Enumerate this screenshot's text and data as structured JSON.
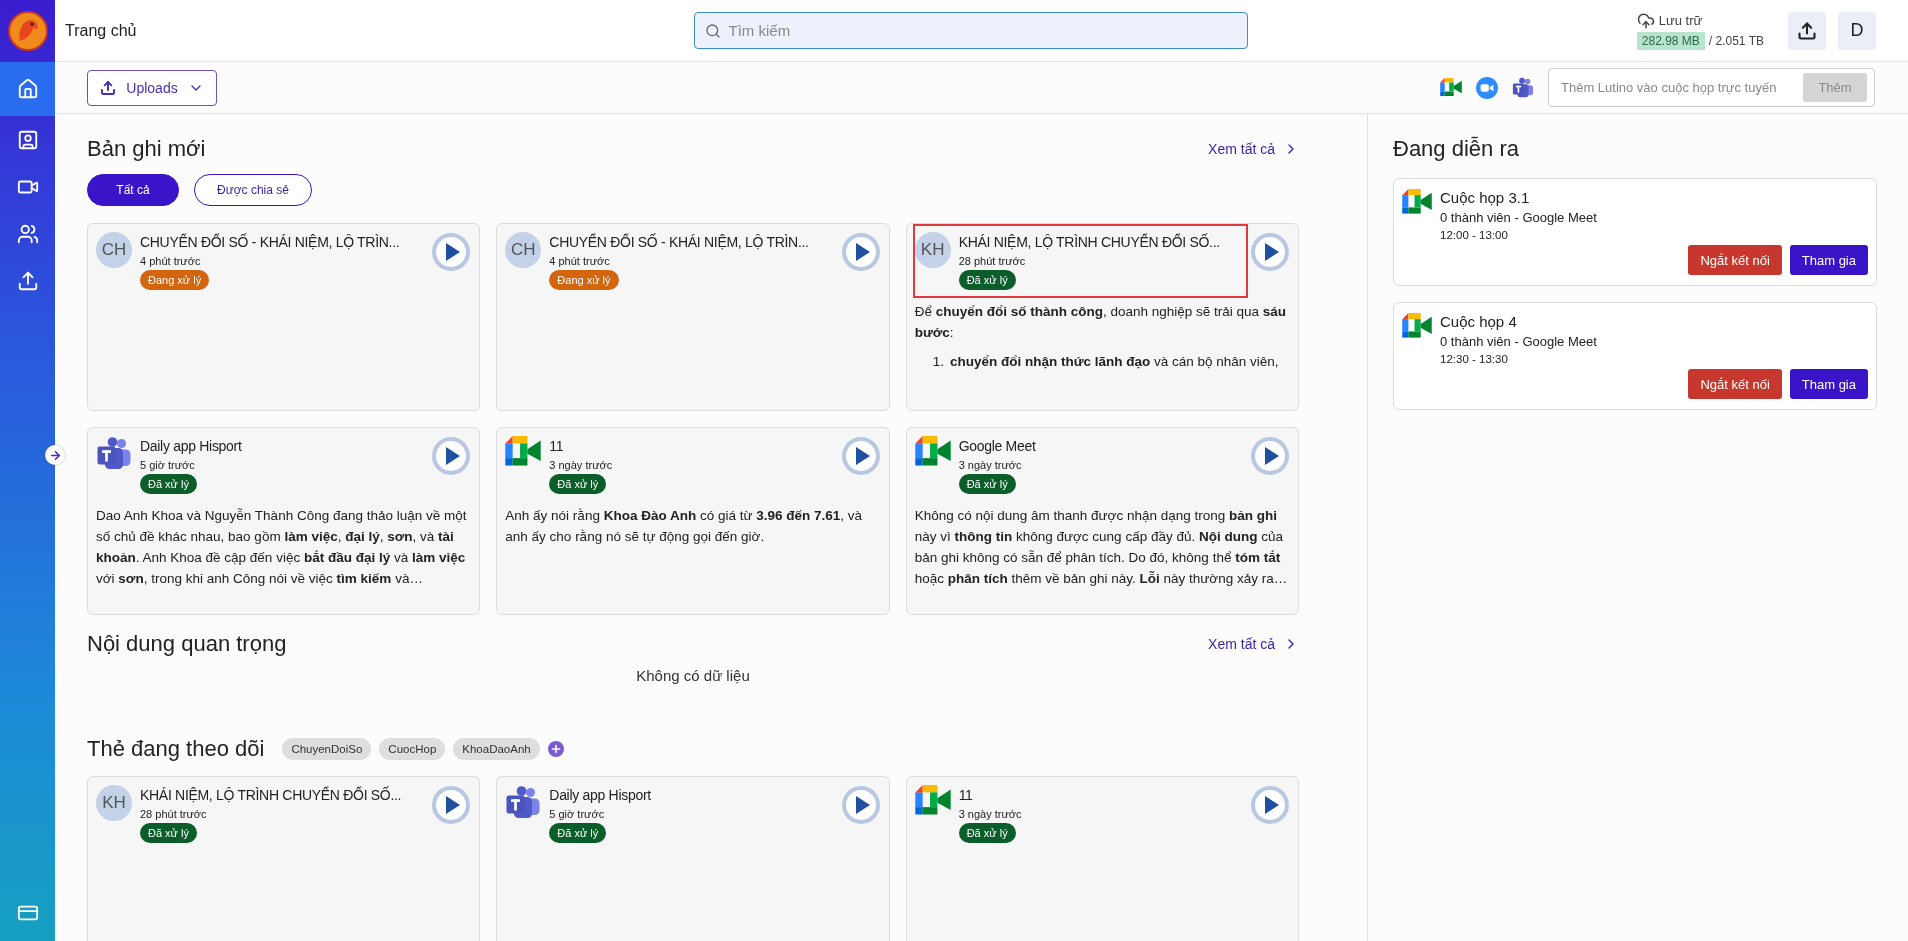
{
  "sidebar": {
    "items": [
      {
        "kind": "home",
        "selected": true
      },
      {
        "kind": "contacts",
        "selected": false
      },
      {
        "kind": "video",
        "selected": false
      },
      {
        "kind": "group",
        "selected": false
      },
      {
        "kind": "upload",
        "selected": false
      }
    ]
  },
  "header": {
    "title": "Trang chủ",
    "search_placeholder": "Tìm kiếm",
    "storage": {
      "label": "Lưu trữ",
      "used": "282.98 MB",
      "total": "/ 2.051 TB"
    },
    "avatar": "D"
  },
  "toolbar": {
    "uploads_label": "Uploads",
    "meeting_placeholder": "Thêm Lutino vào cuộc họp trực tuyến",
    "add_button": {
      "label": "Thêm",
      "disabled": true
    }
  },
  "recent": {
    "title": "Bản ghi mới",
    "view_all": "Xem tất cả",
    "filters": [
      {
        "label": "Tất cả",
        "selected": true
      },
      {
        "label": "Được chia sẻ",
        "selected": false
      }
    ],
    "cards": [
      {
        "kind": "avatar",
        "initials": "CH",
        "title": "CHUYỂN ĐỔI SỐ - KHÁI NIỆM, LỘ TRÌN...",
        "time": "4 phút trước",
        "status": {
          "label": "Đang xử lý",
          "kind": "processing"
        },
        "highlighted": false
      },
      {
        "kind": "avatar",
        "initials": "CH",
        "title": "CHUYỂN ĐỔI SỐ - KHÁI NIỆM, LỘ TRÌN...",
        "time": "4 phút trước",
        "status": {
          "label": "Đang xử lý",
          "kind": "processing"
        },
        "highlighted": false
      },
      {
        "kind": "avatar",
        "initials": "KH",
        "title": "KHÁI NIỆM, LỘ TRÌNH CHUYỂN ĐỔI SỐ...",
        "time": "28 phút trước",
        "status": {
          "label": "Đã xử lý",
          "kind": "done"
        },
        "highlighted": true,
        "body": [
          {
            "kind": "paragraph",
            "text": "Để **chuyển đổi số thành công**, doanh nghiệp sẽ trải qua **sáu bước**:"
          },
          {
            "kind": "list_item",
            "marker": "1.",
            "text": "**chuyển đổi nhận thức lãnh đạo** và cán bộ nhân viên,"
          }
        ]
      },
      {
        "kind": "teams",
        "title": "Daily app Hisport",
        "time": "5 giờ trước",
        "status": {
          "label": "Đã xử lý",
          "kind": "done"
        },
        "highlighted": false,
        "body": [
          {
            "kind": "paragraph",
            "text": "Dao Anh Khoa và Nguyễn Thành Công đang thảo luận về một số chủ đề khác nhau, bao gồm **làm việc**, **đại lý**, **sơn**, và **tài khoản**. Anh Khoa đề cập đến việc **bắt đầu đại lý** và **làm việc** với **sơn**, trong khi anh Công nói về việc **tìm kiếm** và…"
          }
        ]
      },
      {
        "kind": "meet",
        "title": "11",
        "time": "3 ngày trước",
        "status": {
          "label": "Đã xử lý",
          "kind": "done"
        },
        "highlighted": false,
        "body": [
          {
            "kind": "paragraph",
            "text": "Anh ấy nói rằng **Khoa Đào Anh** có giá từ **3.96 đến 7.61**, và anh ấy cho rằng nó sẽ tự động gọi đến giờ."
          }
        ]
      },
      {
        "kind": "meet",
        "title": "Google Meet",
        "time": "3 ngày trước",
        "status": {
          "label": "Đã xử lý",
          "kind": "done"
        },
        "highlighted": false,
        "body": [
          {
            "kind": "paragraph",
            "text": "Không có nội dung âm thanh được nhận dạng trong **bản ghi** này vì **thông tin** không được cung cấp đầy đủ. **Nội dung** của bản ghi không có sẵn để phân tích. Do đó, không thể **tóm tắt** hoặc **phân tích** thêm về bản ghi này. **Lỗi** này thường xảy ra…"
          }
        ]
      }
    ]
  },
  "important": {
    "title": "Nội dung quan trọng",
    "view_all": "Xem tất cả",
    "empty_text": "Không có dữ liệu"
  },
  "tracked": {
    "title": "Thẻ đang theo dõi",
    "tags": [
      "ChuyenDoiSo",
      "CuocHop",
      "KhoaDaoAnh"
    ],
    "cards": [
      {
        "kind": "avatar",
        "initials": "KH",
        "title": "KHÁI NIỆM, LỘ TRÌNH CHUYỂN ĐỔI SỐ...",
        "time": "28 phút trước",
        "status": {
          "label": "Đã xử lý",
          "kind": "done"
        },
        "highlighted": false
      },
      {
        "kind": "teams",
        "title": "Daily app Hisport",
        "time": "5 giờ trước",
        "status": {
          "label": "Đã xử lý",
          "kind": "done"
        },
        "highlighted": false
      },
      {
        "kind": "meet",
        "title": "11",
        "time": "3 ngày trước",
        "status": {
          "label": "Đã xử lý",
          "kind": "done"
        },
        "highlighted": false
      }
    ]
  },
  "live": {
    "title": "Đang diễn ra",
    "meetings": [
      {
        "title": "Cuộc họp 3.1",
        "subtitle": "0 thành viên - Google Meet",
        "time": "12:00 - 13:00",
        "buttons": [
          {
            "label": "Ngắt kết nối",
            "kind": "disconnect"
          },
          {
            "label": "Tham gia",
            "kind": "join"
          }
        ]
      },
      {
        "title": "Cuộc họp 4",
        "subtitle": "0 thành viên - Google Meet",
        "time": "12:30 - 13:30",
        "buttons": [
          {
            "label": "Ngắt kết nối",
            "kind": "disconnect"
          },
          {
            "label": "Tham gia",
            "kind": "join"
          }
        ]
      }
    ]
  }
}
